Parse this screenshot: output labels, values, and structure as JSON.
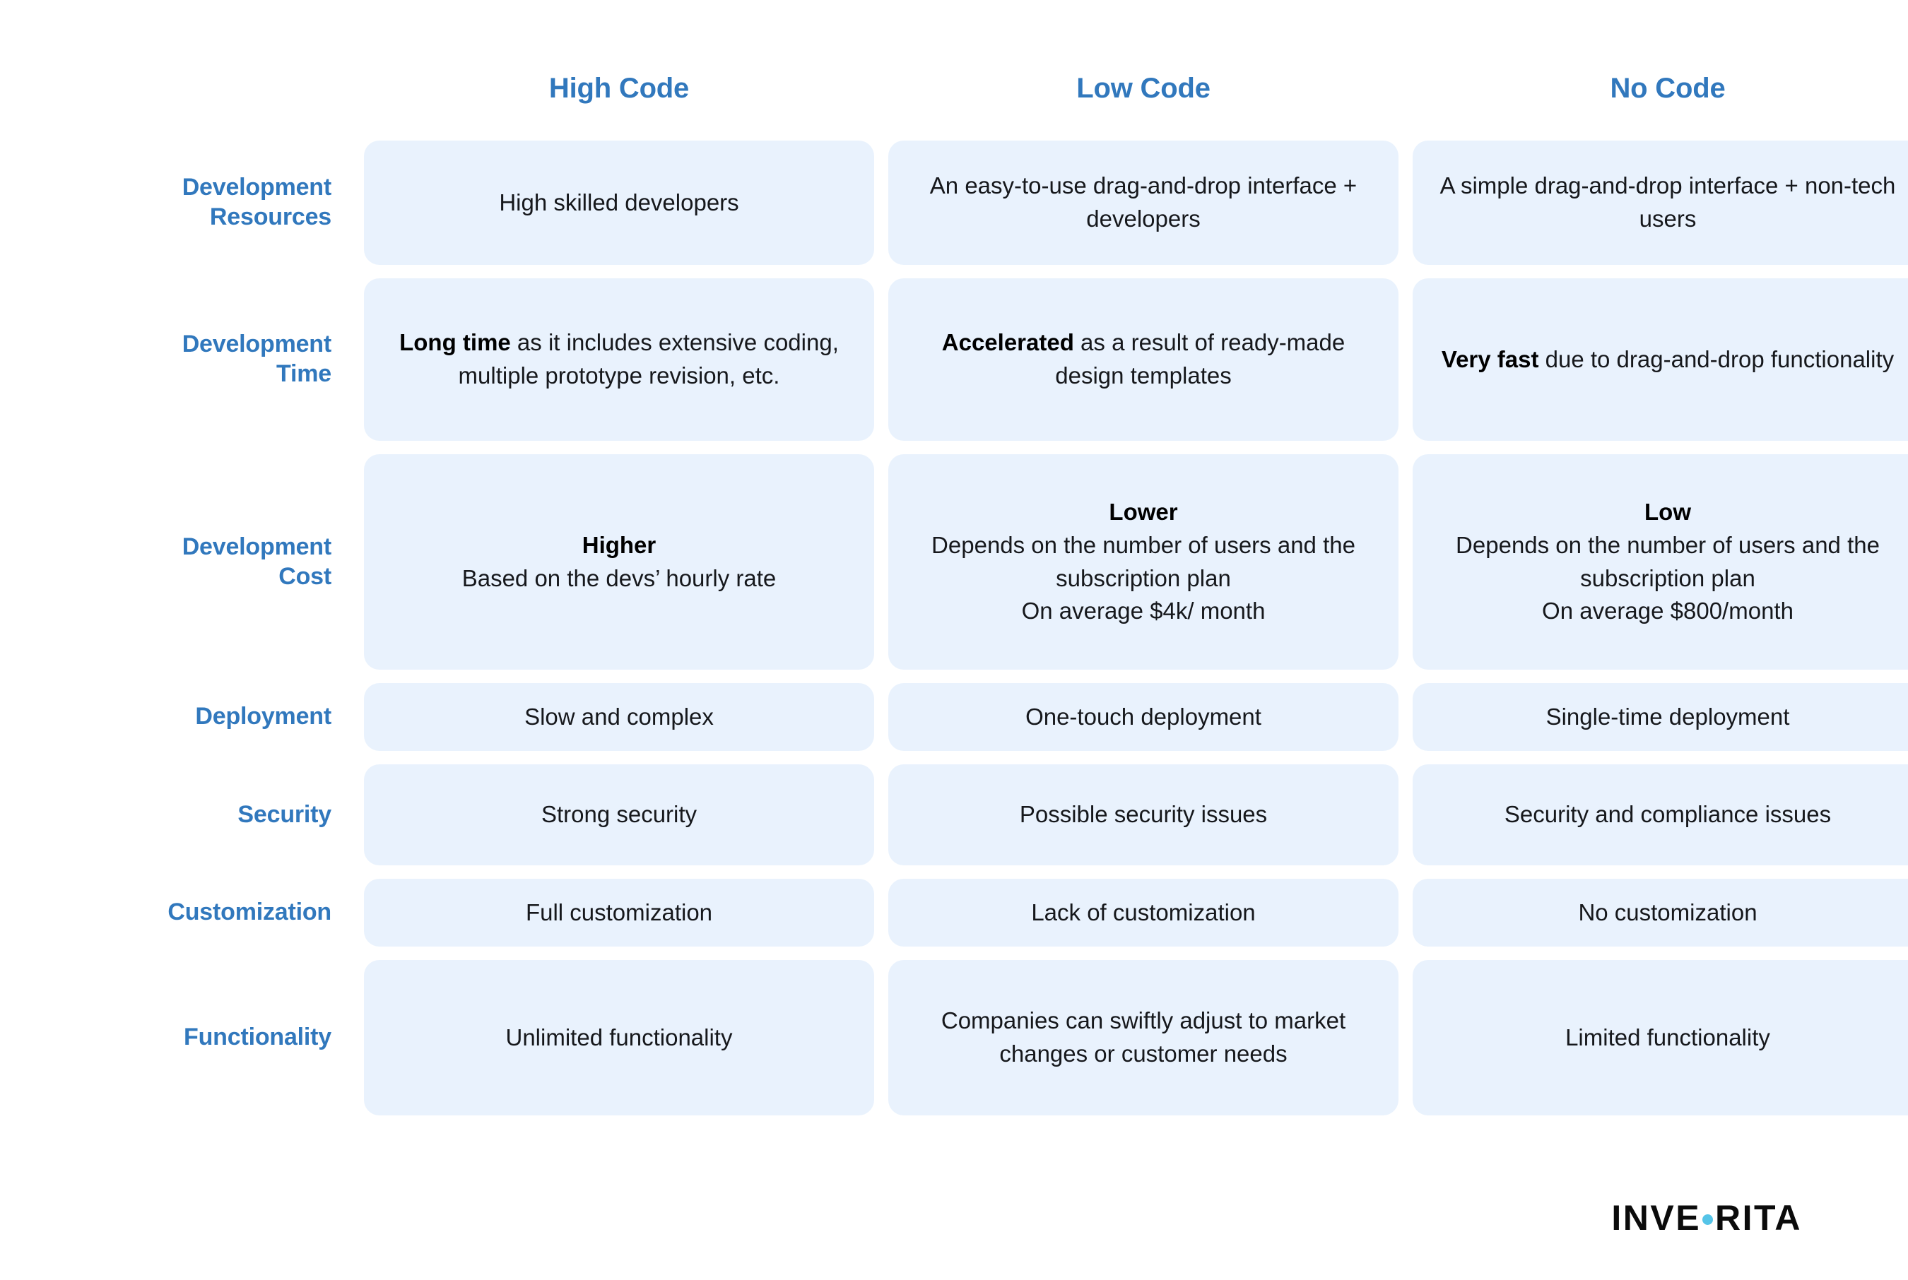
{
  "colors": {
    "accent_blue": "#3178bd",
    "cell_bg": "#e9f2fd",
    "text_dark": "#16181c",
    "logo_dot": "#55c4e8",
    "page_bg": "#ffffff"
  },
  "columns": [
    {
      "label": "High Code"
    },
    {
      "label": "Low Code"
    },
    {
      "label": "No Code"
    }
  ],
  "rows": [
    {
      "label": "Development\nResources",
      "cells": [
        {
          "lead": "",
          "text": "High skilled developers"
        },
        {
          "lead": "",
          "text": "An easy-to-use drag-and-drop interface + developers"
        },
        {
          "lead": "",
          "text": "A simple drag-and-drop interface + non-tech users"
        }
      ]
    },
    {
      "label": "Development\nTime",
      "cells": [
        {
          "lead": "Long time",
          "text": " as it includes extensive coding, multiple prototype revision, etc."
        },
        {
          "lead": "Accelerated",
          "text": " as a result of ready-made design templates"
        },
        {
          "lead": "Very fast",
          "text": " due to drag-and-drop functionality"
        }
      ]
    },
    {
      "label": "Development\nCost",
      "cells": [
        {
          "lead": "Higher",
          "text": "\nBased on the devs’ hourly rate"
        },
        {
          "lead": "Lower",
          "text": "\nDepends on the number of users and the subscription plan\nOn average $4k/ month"
        },
        {
          "lead": "Low",
          "text": "\nDepends on the number of users and the subscription plan\nOn average $800/month"
        }
      ]
    },
    {
      "label": "Deployment",
      "cells": [
        {
          "lead": "",
          "text": "Slow and complex"
        },
        {
          "lead": "",
          "text": "One-touch deployment"
        },
        {
          "lead": "",
          "text": "Single-time deployment"
        }
      ]
    },
    {
      "label": "Security",
      "cells": [
        {
          "lead": "",
          "text": "Strong security"
        },
        {
          "lead": "",
          "text": "Possible security issues"
        },
        {
          "lead": "",
          "text": "Security and compliance issues"
        }
      ]
    },
    {
      "label": "Customization",
      "cells": [
        {
          "lead": "",
          "text": "Full customization"
        },
        {
          "lead": "",
          "text": "Lack of customization"
        },
        {
          "lead": "",
          "text": "No customization"
        }
      ]
    },
    {
      "label": "Functionality",
      "cells": [
        {
          "lead": "",
          "text": "Unlimited functionality"
        },
        {
          "lead": "",
          "text": "Companies can swiftly adjust to market changes or customer needs"
        },
        {
          "lead": "",
          "text": "Limited functionality"
        }
      ]
    }
  ],
  "logo": {
    "part1": "INVE",
    "part2": "RITA",
    "full": "INVERITA"
  }
}
